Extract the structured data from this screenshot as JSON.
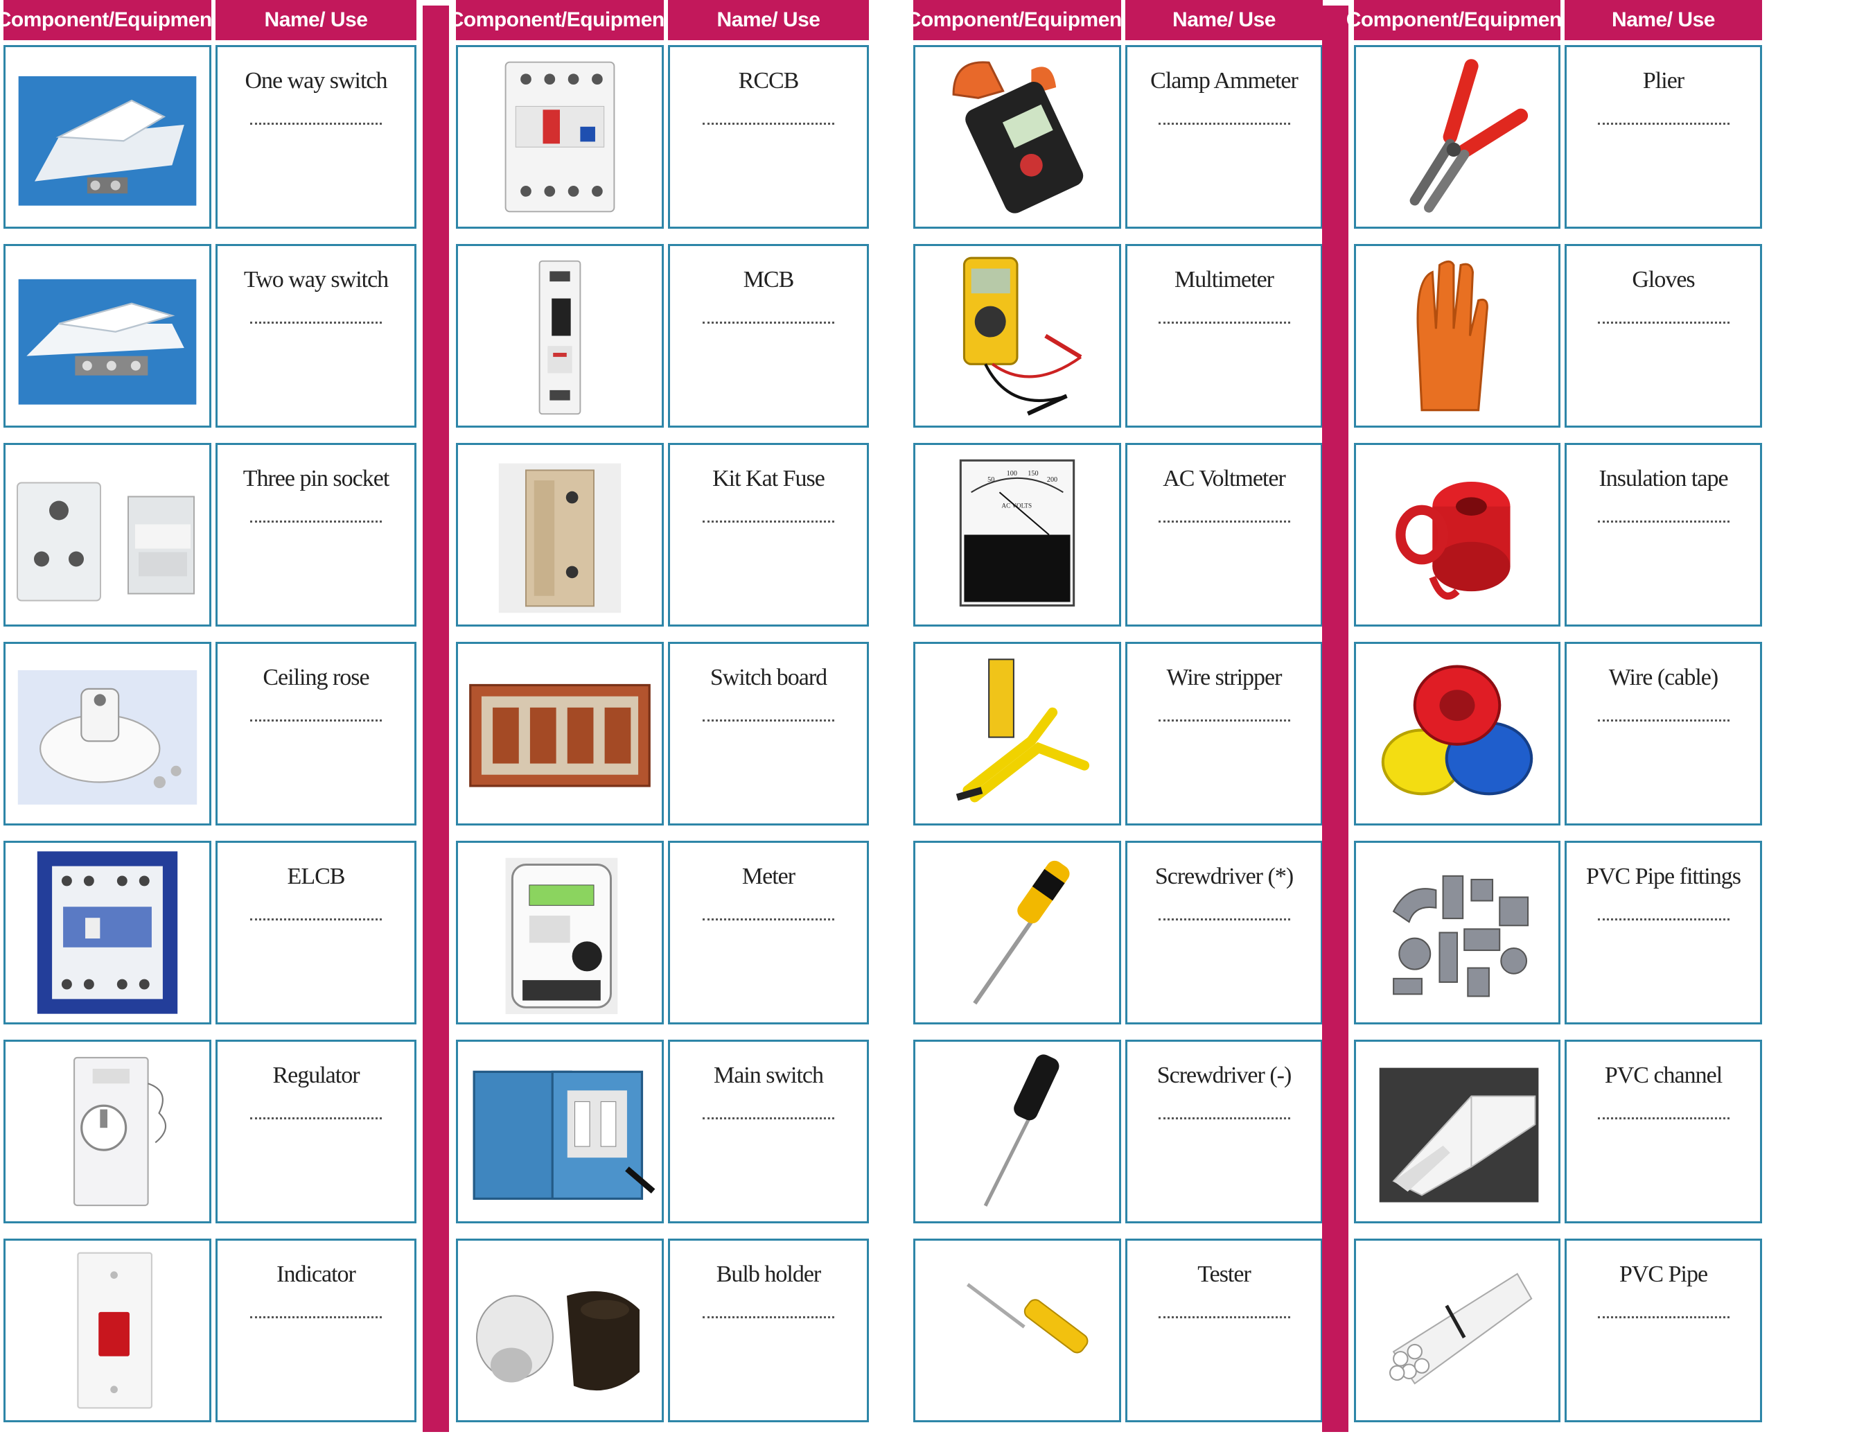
{
  "header": {
    "component_label": "Component/Equipment",
    "name_label": "Name/ Use"
  },
  "columns": [
    {
      "items": [
        {
          "name": "One way switch",
          "icon": "one-way-switch-icon"
        },
        {
          "name": "Two way switch",
          "icon": "two-way-switch-icon"
        },
        {
          "name": "Three pin socket",
          "icon": "three-pin-socket-icon"
        },
        {
          "name": "Ceiling rose",
          "icon": "ceiling-rose-icon"
        },
        {
          "name": "ELCB",
          "icon": "elcb-icon"
        },
        {
          "name": "Regulator",
          "icon": "regulator-icon"
        },
        {
          "name": "Indicator",
          "icon": "indicator-icon"
        }
      ]
    },
    {
      "items": [
        {
          "name": "RCCB",
          "icon": "rccb-icon"
        },
        {
          "name": "MCB",
          "icon": "mcb-icon"
        },
        {
          "name": "Kit Kat Fuse",
          "icon": "kit-kat-fuse-icon"
        },
        {
          "name": "Switch board",
          "icon": "switch-board-icon"
        },
        {
          "name": "Meter",
          "icon": "meter-icon"
        },
        {
          "name": "Main switch",
          "icon": "main-switch-icon"
        },
        {
          "name": "Bulb holder",
          "icon": "bulb-holder-icon"
        }
      ]
    },
    {
      "items": [
        {
          "name": "Clamp Ammeter",
          "icon": "clamp-ammeter-icon"
        },
        {
          "name": "Multimeter",
          "icon": "multimeter-icon"
        },
        {
          "name": "AC Voltmeter",
          "icon": "ac-voltmeter-icon"
        },
        {
          "name": "Wire stripper",
          "icon": "wire-stripper-icon"
        },
        {
          "name": "Screwdriver  (*)",
          "icon": "screwdriver-star-icon"
        },
        {
          "name": "Screwdriver  (-)",
          "icon": "screwdriver-flat-icon"
        },
        {
          "name": "Tester",
          "icon": "tester-icon"
        }
      ]
    },
    {
      "items": [
        {
          "name": "Plier",
          "icon": "plier-icon"
        },
        {
          "name": "Gloves",
          "icon": "gloves-icon"
        },
        {
          "name": "Insulation  tape",
          "icon": "insulation-tape-icon"
        },
        {
          "name": "Wire (cable)",
          "icon": "wire-cable-icon"
        },
        {
          "name": "PVC Pipe fittings",
          "icon": "pvc-pipe-fittings-icon"
        },
        {
          "name": "PVC channel",
          "icon": "pvc-channel-icon"
        },
        {
          "name": "PVC Pipe",
          "icon": "pvc-pipe-icon"
        }
      ]
    }
  ],
  "voltmeter_scale": {
    "ticks": [
      "50",
      "100",
      "150",
      "200"
    ],
    "unit": "AC VOLTS"
  },
  "colors": {
    "accent": "#c2185b",
    "border": "#2e86a8"
  }
}
